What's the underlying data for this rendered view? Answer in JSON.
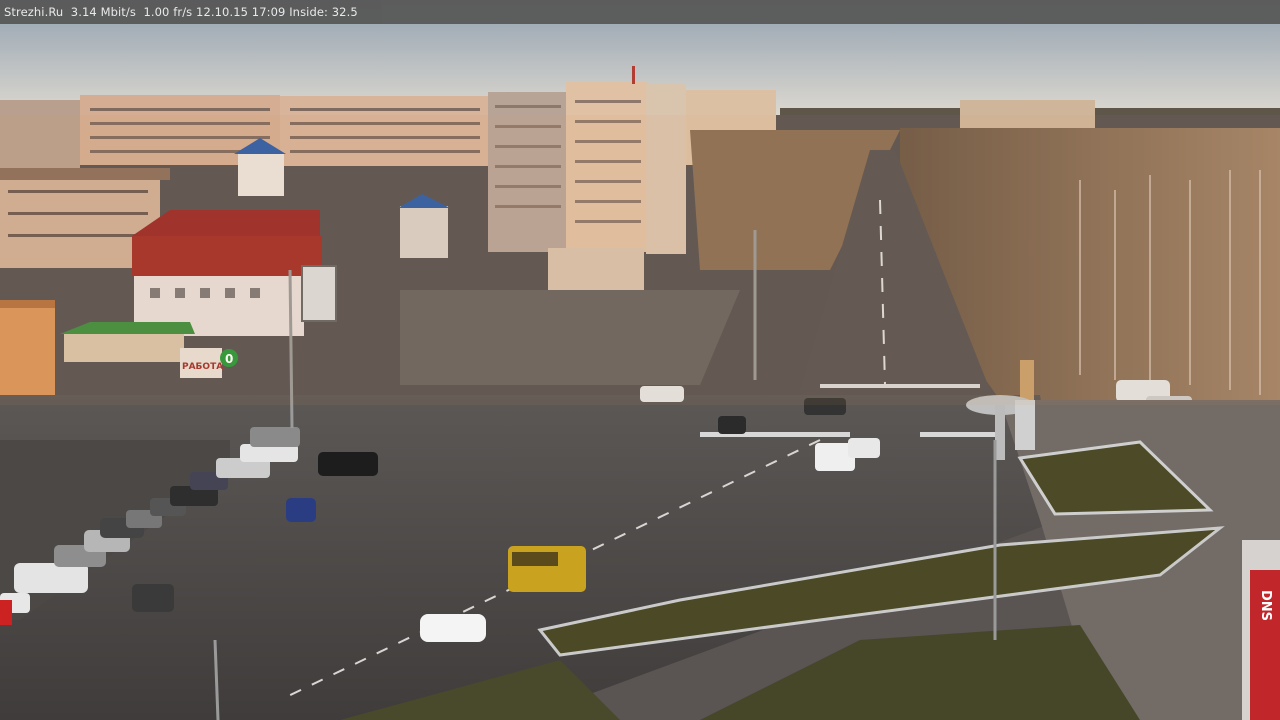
{
  "camera_overlay": {
    "text": "Strezhi.Ru  3.14 Mbit/s  1.00 fr/s 12.10.15 17:09 Inside: 32.5"
  },
  "scene": {
    "billboard_text": "РАБОТА",
    "billboard_digit": "0",
    "shop_sign_text": "DNS",
    "colors": {
      "sky_top": "#9aa7b3",
      "sky_bottom": "#d9d6cf",
      "asphalt": "#4e4a48",
      "building_lit": "#d9b497",
      "red_roof": "#a3302b",
      "grass": "#4d4a2a",
      "bus": "#c9a21f",
      "dns_red": "#c1262b"
    }
  }
}
